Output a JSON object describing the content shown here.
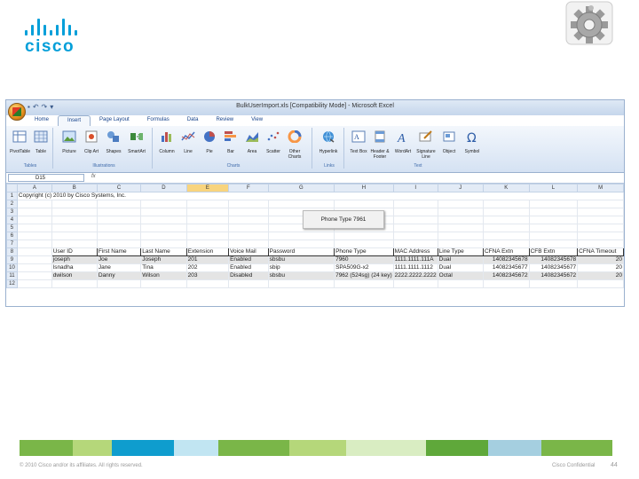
{
  "brand": {
    "logo_text": "cisco",
    "accent": "#049fd9"
  },
  "window": {
    "title": "BulkUserImport.xls [Compatibility Mode] - Microsoft Excel",
    "tabs": [
      "Home",
      "Insert",
      "Page Layout",
      "Formulas",
      "Data",
      "Review",
      "View"
    ],
    "active_tab": "Insert"
  },
  "ribbon": {
    "groups": [
      {
        "label": "Tables",
        "buttons": [
          "PivotTable",
          "Table"
        ]
      },
      {
        "label": "Illustrations",
        "buttons": [
          "Picture",
          "Clip Art",
          "Shapes",
          "SmartArt"
        ]
      },
      {
        "label": "Charts",
        "buttons": [
          "Column",
          "Line",
          "Pie",
          "Bar",
          "Area",
          "Scatter",
          "Other Charts"
        ]
      },
      {
        "label": "Links",
        "buttons": [
          "Hyperlink"
        ]
      },
      {
        "label": "Text",
        "buttons": [
          "Text Box",
          "Header & Footer",
          "WordArt",
          "Signature Line",
          "Object",
          "Symbol"
        ]
      }
    ]
  },
  "formula_bar": {
    "name_box": "D15",
    "fx": "fx",
    "value": ""
  },
  "sheet": {
    "columns": [
      "A",
      "B",
      "C",
      "D",
      "E",
      "F",
      "G",
      "H",
      "I",
      "J",
      "K",
      "L",
      "M"
    ],
    "selected_column": "E",
    "row_numbers": [
      "1",
      "2",
      "3",
      "4",
      "5",
      "6",
      "7",
      "8",
      "9",
      "10",
      "11",
      "12"
    ],
    "copyright": "Copyright (c) 2010 by Cisco Systems, Inc.",
    "headers": [
      "User ID",
      "First Name",
      "Last Name",
      "Extension",
      "Voice Mail",
      "Password",
      "Phone Type",
      "MAC Address",
      "Line Type",
      "CFNA Extn",
      "CFB Extn",
      "CFNA Timeout"
    ],
    "rows": [
      [
        "joseph",
        "Joe",
        "Joseph",
        "201",
        "Enabled",
        "sbsbu",
        "7960",
        "1111.1111.111A",
        "Dual",
        "14082345678",
        "14082345678",
        "20"
      ],
      [
        "lsnadha",
        "Jane",
        "Tina",
        "202",
        "Enabled",
        "sbip",
        "SPA509G-x2",
        "1111.1111.1112",
        "Dual",
        "14082345677",
        "14082345677",
        "20"
      ],
      [
        "dwilson",
        "Danny",
        "Wilson",
        "203",
        "Disabled",
        "sbsbu",
        "7962 (524sg)   (24 key)",
        "2222.2222.2222",
        "Octal",
        "14082345672",
        "14082345672",
        "20"
      ]
    ]
  },
  "phone_type_popup": "Phone Type 7961",
  "footer": {
    "copyright": "© 2010 Cisco and/or its affiliates. All rights reserved.",
    "confidential": "Cisco Confidential",
    "page_number": "44",
    "strip_colors": [
      "#7ab648",
      "#b5d77a",
      "#0f9dce",
      "#c1e5f2",
      "#7ab648",
      "#b5d77a",
      "#d9edc2",
      "#5fa83a",
      "#a5cfe0"
    ]
  }
}
